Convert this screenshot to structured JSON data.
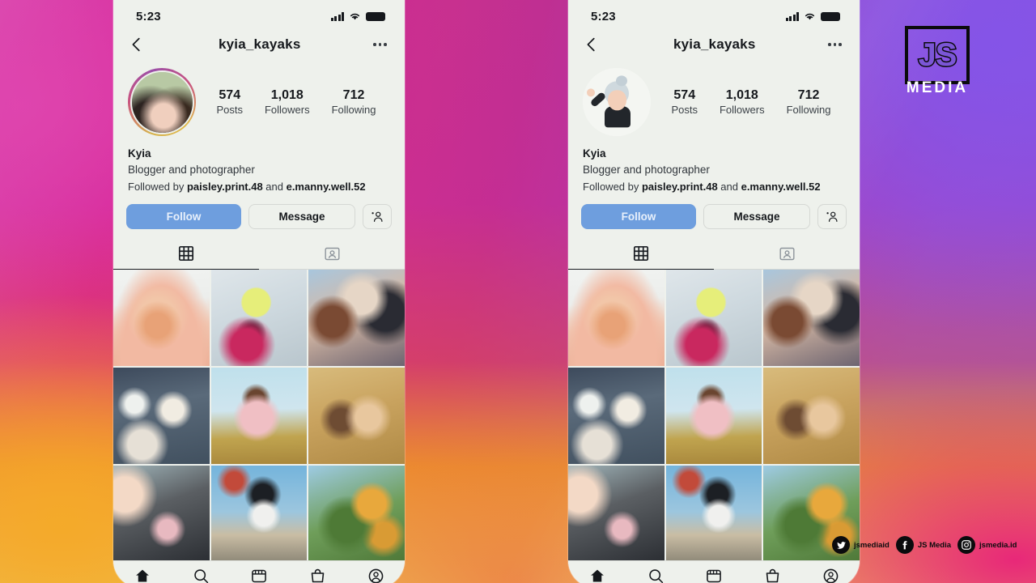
{
  "background": {
    "gradient_colors": [
      "#d94bb0",
      "#d6269a",
      "#f5aa28",
      "#8257e6",
      "#e8187d"
    ]
  },
  "brand": {
    "logo_js": "JS",
    "logo_media": "MEDIA",
    "accent": "#7b56d6",
    "social": [
      {
        "icon": "twitter-icon",
        "handle": "jsmediaid"
      },
      {
        "icon": "facebook-icon",
        "handle": "JS Media"
      },
      {
        "icon": "instagram-icon",
        "handle": "jsmedia.id"
      }
    ]
  },
  "phone": {
    "statusbar": {
      "time": "5:23",
      "signal_icon": "cellular-signal-icon",
      "wifi_icon": "wifi-icon",
      "battery_icon": "battery-full-icon"
    },
    "header": {
      "back_icon": "back-chevron-icon",
      "username": "kyia_kayaks",
      "more_icon": "more-options-icon"
    },
    "profile": {
      "avatar_icon": "profile-avatar",
      "stats": [
        {
          "num": "574",
          "label": "Posts"
        },
        {
          "num": "1,018",
          "label": "Followers"
        },
        {
          "num": "712",
          "label": "Following"
        }
      ],
      "display_name": "Kyia",
      "bio": "Blogger and photographer",
      "followed_by_prefix": "Followed by ",
      "followed_by_1": "paisley.print.48",
      "followed_by_join": " and ",
      "followed_by_2": "e.manny.well.52"
    },
    "actions": {
      "follow_label": "Follow",
      "follow_color": "#6e9ede",
      "message_label": "Message",
      "adduser_icon": "add-person-icon"
    },
    "tabs": [
      {
        "icon": "grid-posts-icon",
        "active": true
      },
      {
        "icon": "tagged-photos-icon",
        "active": false
      }
    ],
    "grid": {
      "cells": [
        {
          "id": "post-1",
          "alt": "person in pink fur hood"
        },
        {
          "id": "post-2",
          "alt": "hand holding yellow smiley balloon"
        },
        {
          "id": "post-3",
          "alt": "group of friends posing"
        },
        {
          "id": "post-4",
          "alt": "kids on a night street"
        },
        {
          "id": "post-5",
          "alt": "person in pink hoodie by the sea"
        },
        {
          "id": "post-6",
          "alt": "two people in warm-toned room"
        },
        {
          "id": "post-7",
          "alt": "hand reaching over dark flowers"
        },
        {
          "id": "post-8",
          "alt": "woman in sunglasses by road sign"
        },
        {
          "id": "post-9",
          "alt": "oranges growing on a tree"
        }
      ]
    },
    "bottomnav": [
      {
        "icon": "home-icon",
        "active": true
      },
      {
        "icon": "search-icon",
        "active": false
      },
      {
        "icon": "reels-icon",
        "active": false
      },
      {
        "icon": "shop-icon",
        "active": false
      },
      {
        "icon": "profile-icon",
        "active": false
      }
    ]
  }
}
